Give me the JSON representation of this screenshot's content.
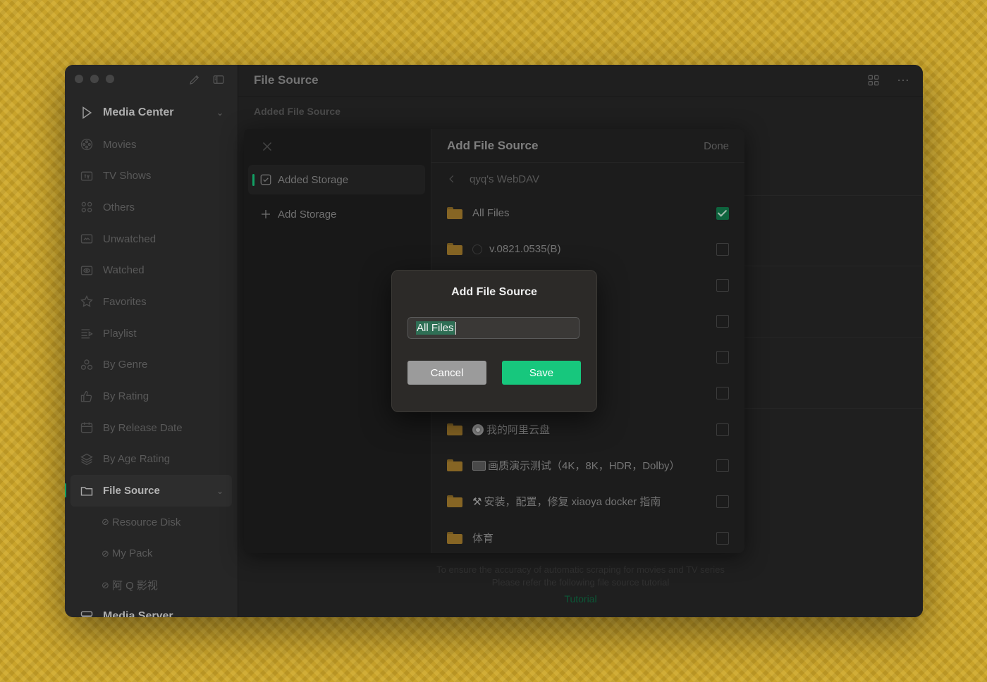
{
  "sidebar": {
    "media_center_label": "Media Center",
    "items": [
      "Movies",
      "TV Shows",
      "Others",
      "Unwatched",
      "Watched",
      "Favorites",
      "Playlist",
      "By Genre",
      "By Rating",
      "By Release Date",
      "By Age Rating"
    ],
    "file_source_label": "File Source",
    "sub_items": [
      "Resource Disk",
      "My Pack",
      "阿 Q 影视"
    ],
    "media_server_label": "Media Server"
  },
  "main": {
    "title": "File Source",
    "section_title": "Added File Source",
    "footer_line1": "To ensure the accuracy of automatic scraping for movies and TV series",
    "footer_line2": "Please refer the following file source tutorial",
    "tutorial_link": "Tutorial"
  },
  "sheet": {
    "tab_added_storage": "Added Storage",
    "tab_add_storage": "Add Storage",
    "title": "Add File Source",
    "done_label": "Done",
    "breadcrumb": "qyq's WebDAV",
    "files": [
      {
        "name": "All Files",
        "checked": true
      },
      {
        "name": "v.0821.0535(B)",
        "checked": false
      },
      {
        "name": "",
        "checked": false
      },
      {
        "name": "",
        "checked": false
      },
      {
        "name": "",
        "checked": false
      },
      {
        "name": "",
        "checked": false
      },
      {
        "name": "我的阿里云盘",
        "checked": false
      },
      {
        "name": "画质演示测试（4K，8K，HDR，Dolby）",
        "checked": false
      },
      {
        "name": "安装，配置，修复 xiaoya docker 指南",
        "checked": false
      },
      {
        "name": "体育",
        "checked": false
      }
    ]
  },
  "dialog": {
    "title": "Add File Source",
    "input_value": "All Files",
    "cancel_label": "Cancel",
    "save_label": "Save"
  },
  "colors": {
    "accent": "#17c77d",
    "background": "#c9a32a"
  }
}
